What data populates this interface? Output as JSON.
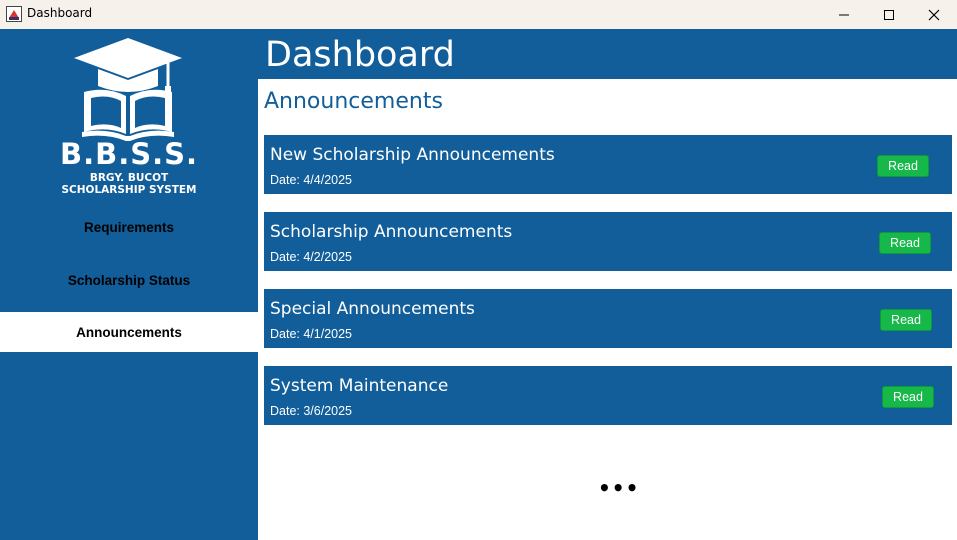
{
  "window": {
    "title": "Dashboard",
    "controls": [
      "minimize-icon",
      "maximize-icon",
      "close-icon"
    ]
  },
  "sidebar": {
    "logo": {
      "title": "B.B.S.S.",
      "subtitle_line1": "BRGY. BUCOT",
      "subtitle_line2": "SCHOLARSHIP SYSTEM",
      "icon": "graduation-cap-book-icon"
    },
    "items": [
      {
        "label": "Requirements",
        "active": false
      },
      {
        "label": "Scholarship Status",
        "active": false
      },
      {
        "label": "Announcements",
        "active": true
      }
    ]
  },
  "header": {
    "title": "Dashboard"
  },
  "main": {
    "section_title": "Announcements",
    "announcements": [
      {
        "title": "New Scholarship Announcements",
        "date": "Date: 4/4/2025",
        "button": "Read"
      },
      {
        "title": "Scholarship Announcements",
        "date": "Date: 4/2/2025",
        "button": "Read"
      },
      {
        "title": "Special Announcements",
        "date": "Date: 4/1/2025",
        "button": "Read"
      },
      {
        "title": "System Maintenance",
        "date": "Date: 3/6/2025",
        "button": "Read"
      }
    ],
    "more_indicator": "•••"
  },
  "colors": {
    "primary": "#115e9a",
    "button_green": "#17b84a",
    "title_bar": "#f7f1ec"
  }
}
